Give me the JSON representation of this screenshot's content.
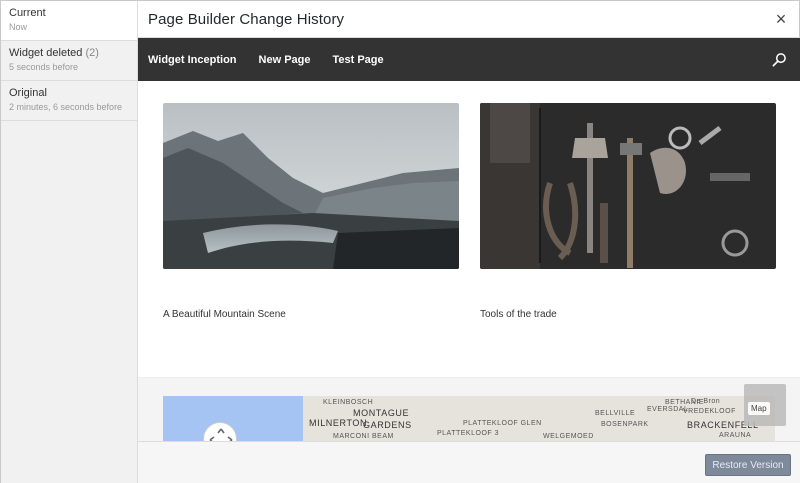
{
  "revisions": [
    {
      "name": "Current",
      "count": "",
      "time": "Now"
    },
    {
      "name": "Widget deleted",
      "count": "(2)",
      "time": "5 seconds before"
    },
    {
      "name": "Original",
      "count": "",
      "time": "2 minutes, 6 seconds before"
    }
  ],
  "header": {
    "title": "Page Builder Change History",
    "close_label": "×"
  },
  "nav": {
    "items": [
      "Widget Inception",
      "New Page",
      "Test Page"
    ],
    "search_icon": "search-icon"
  },
  "gallery": [
    {
      "caption": "A Beautiful Mountain Scene"
    },
    {
      "caption": "Tools of the trade"
    }
  ],
  "map": {
    "button_label": "Map",
    "labels": [
      "KLEINBOSCH",
      "MONTAGUE",
      "GARDENS",
      "MILNERTON",
      "MARCONI BEAM",
      "PLATTEKLOOF 3",
      "WELGEMOED",
      "BELLVILLE",
      "BOSENPARK",
      "EVERSDAL",
      "BETHANIE",
      "VREDEKLOOF",
      "BRACKENFELL",
      "ARAUNA",
      "De Bron",
      "PLATTEKLOOF GLEN"
    ]
  },
  "footer": {
    "restore_label": "Restore Version"
  },
  "colors": {
    "nav_bg": "#333333",
    "restore_bg": "#7e8a99",
    "water": "#a5c4f4"
  }
}
